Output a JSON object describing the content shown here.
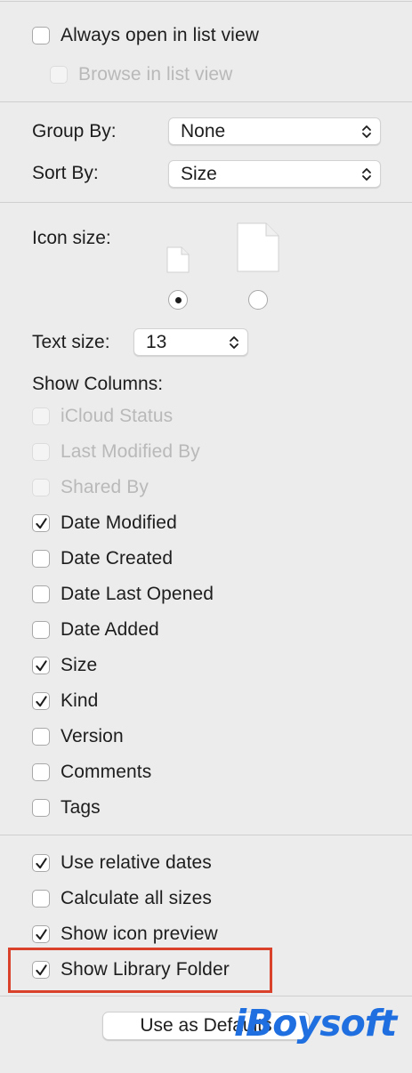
{
  "top_section": {
    "always_open_list": {
      "label": "Always open in list view",
      "checked": false
    },
    "browse_list": {
      "label": "Browse in list view",
      "checked": false,
      "disabled": true
    }
  },
  "grouping": {
    "group_by_label": "Group By:",
    "group_by_value": "None",
    "sort_by_label": "Sort By:",
    "sort_by_value": "Size"
  },
  "icon_size": {
    "label": "Icon size:",
    "selected": "small"
  },
  "text_size": {
    "label": "Text size:",
    "value": "13"
  },
  "columns": {
    "heading": "Show Columns:",
    "items": [
      {
        "label": "iCloud Status",
        "checked": false,
        "disabled": true
      },
      {
        "label": "Last Modified By",
        "checked": false,
        "disabled": true
      },
      {
        "label": "Shared By",
        "checked": false,
        "disabled": true
      },
      {
        "label": "Date Modified",
        "checked": true,
        "disabled": false
      },
      {
        "label": "Date Created",
        "checked": false,
        "disabled": false
      },
      {
        "label": "Date Last Opened",
        "checked": false,
        "disabled": false
      },
      {
        "label": "Date Added",
        "checked": false,
        "disabled": false
      },
      {
        "label": "Size",
        "checked": true,
        "disabled": false
      },
      {
        "label": "Kind",
        "checked": true,
        "disabled": false
      },
      {
        "label": "Version",
        "checked": false,
        "disabled": false
      },
      {
        "label": "Comments",
        "checked": false,
        "disabled": false
      },
      {
        "label": "Tags",
        "checked": false,
        "disabled": false
      }
    ]
  },
  "options": {
    "items": [
      {
        "label": "Use relative dates",
        "checked": true
      },
      {
        "label": "Calculate all sizes",
        "checked": false
      },
      {
        "label": "Show icon preview",
        "checked": true
      },
      {
        "label": "Show Library Folder",
        "checked": true
      }
    ]
  },
  "footer": {
    "default_button": "Use as Defaults"
  },
  "watermark": "iBoysoft",
  "colors": {
    "highlight": "#d9412b",
    "watermark": "#1f6fe0"
  }
}
